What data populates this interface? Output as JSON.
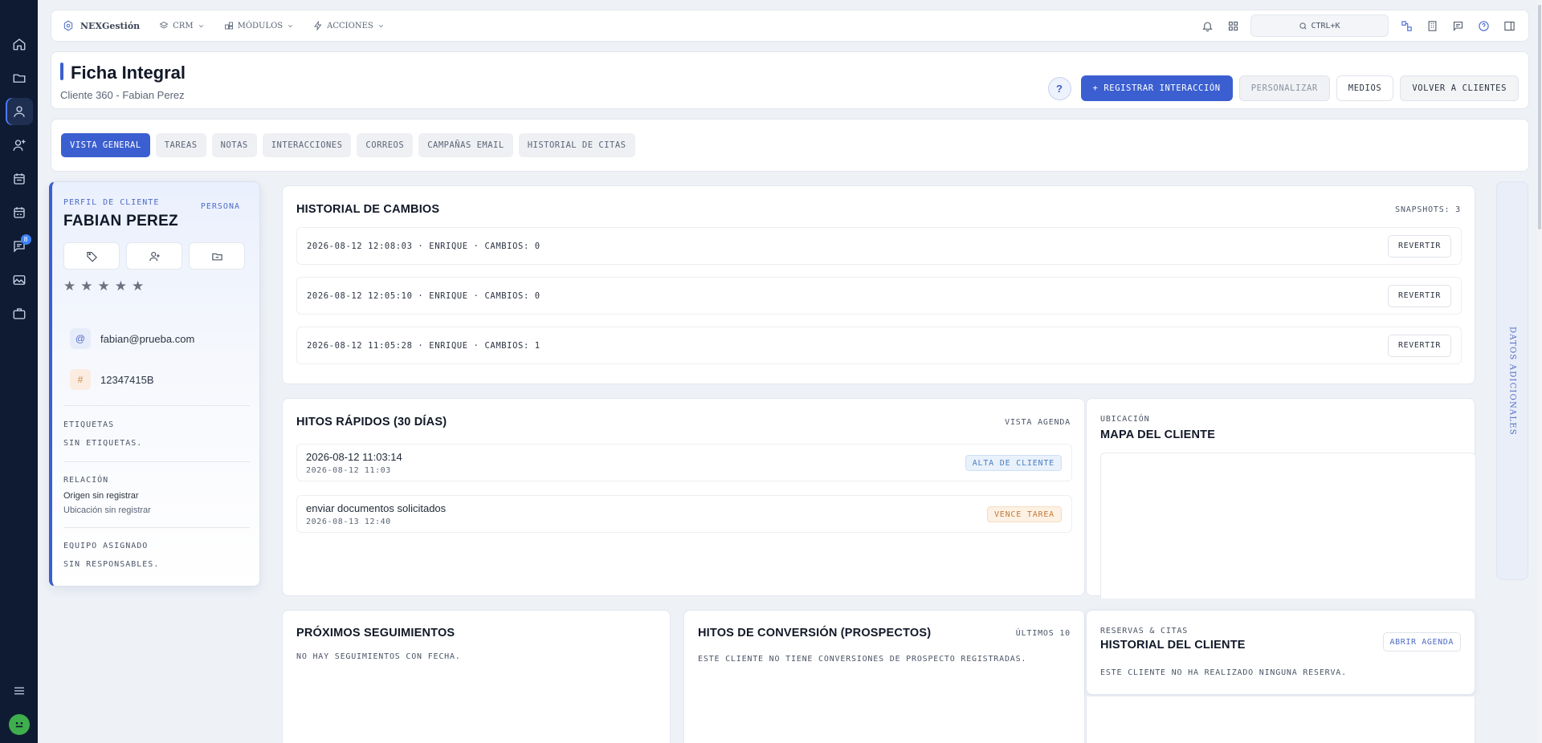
{
  "rail": {
    "items": [
      {
        "icon": "home-icon"
      },
      {
        "icon": "folder-icon"
      },
      {
        "icon": "user-icon",
        "active": true
      },
      {
        "icon": "user-plus-icon"
      },
      {
        "icon": "calendar-icon"
      },
      {
        "icon": "calendar-check-icon"
      },
      {
        "icon": "chat-icon",
        "badge": "8"
      },
      {
        "icon": "image-icon"
      },
      {
        "icon": "briefcase-icon"
      }
    ]
  },
  "topbar": {
    "brand": "NEXGestión",
    "menus": [
      "CRM",
      "MÓDULOS",
      "ACCIONES"
    ],
    "search_shortcut": "CTRL+K"
  },
  "header": {
    "title": "Ficha Integral",
    "subtitle": "Cliente 360 - Fabian Perez",
    "help": "?",
    "btn_register": "+ REGISTRAR INTERACCIÓN",
    "btn_customize": "PERSONALIZAR",
    "btn_media": "MEDIOS",
    "btn_back": "VOLVER A CLIENTES"
  },
  "tabs": [
    "VISTA GENERAL",
    "TAREAS",
    "NOTAS",
    "INTERACCIONES",
    "CORREOS",
    "CAMPAÑAS EMAIL",
    "HISTORIAL DE CITAS"
  ],
  "profile": {
    "label": "PERFIL DE CLIENTE",
    "type": "PERSONA",
    "name": "FABIAN PEREZ",
    "rating": 0,
    "email_icon": "@",
    "email": "fabian@prueba.com",
    "id_icon": "#",
    "document": "12347415B",
    "tags_label": "ETIQUETAS",
    "tags_value": "SIN ETIQUETAS.",
    "relation_label": "RELACIÓN",
    "origin": "Origen sin registrar",
    "location": "Ubicación sin registrar",
    "team_label": "EQUIPO ASIGNADO",
    "team_value": "SIN RESPONSABLES."
  },
  "history": {
    "title": "HISTORIAL DE CAMBIOS",
    "meta": "SNAPSHOTS: 3",
    "revert_label": "REVERTIR",
    "rows": [
      "2026-08-12 12:08:03 · ENRIQUE · CAMBIOS: 0",
      "2026-08-12 12:05:10 · ENRIQUE · CAMBIOS: 0",
      "2026-08-12 11:05:28 · ENRIQUE · CAMBIOS: 1"
    ]
  },
  "milestones": {
    "title": "HITOS RÁPIDOS (30 DÍAS)",
    "meta": "VISTA AGENDA",
    "rows": [
      {
        "title": "2026-08-12 11:03:14",
        "date": "2026-08-12 11:03",
        "badge": "ALTA DE CLIENTE",
        "tone": "blue"
      },
      {
        "title": "enviar documentos solicitados",
        "date": "2026-08-13 12:40",
        "badge": "VENCE TAREA",
        "tone": "orange"
      }
    ]
  },
  "map": {
    "label": "UBICACIÓN",
    "title": "MAPA DEL CLIENTE"
  },
  "side_tab": "DATOS ADICIONALES",
  "followups": {
    "title": "PRÓXIMOS SEGUIMIENTOS",
    "empty": "NO HAY SEGUIMIENTOS CON FECHA."
  },
  "conversions": {
    "title": "HITOS DE CONVERSIÓN (PROSPECTOS)",
    "meta": "ÚLTIMOS 10",
    "empty": "ESTE CLIENTE NO TIENE CONVERSIONES DE PROSPECTO REGISTRADAS."
  },
  "bookings": {
    "label": "RESERVAS & CITAS",
    "title": "HISTORIAL DEL CLIENTE",
    "link": "ABRIR AGENDA",
    "empty": "ESTE CLIENTE NO HA REALIZADO NINGUNA RESERVA."
  }
}
